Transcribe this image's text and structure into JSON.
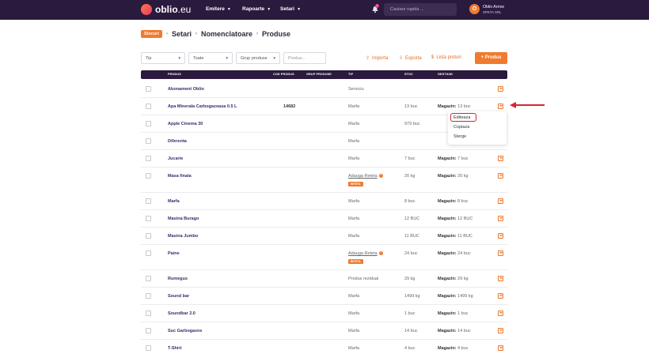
{
  "brand": {
    "name": "oblio",
    "tld": ".eu"
  },
  "nav": [
    {
      "label": "Emitere"
    },
    {
      "label": "Rapoarte"
    },
    {
      "label": "Setari"
    }
  ],
  "notifications": {
    "count": "1"
  },
  "search": {
    "placeholder": "Cautare rapida ..."
  },
  "user": {
    "initial": "O",
    "name": "Oblio Arrow",
    "company": "SPETA SRL"
  },
  "breadcrumb": {
    "badge": "Stocuri",
    "items": [
      "Setari",
      "Nomenclatoare",
      "Produse"
    ]
  },
  "filters": {
    "tip": "Tip",
    "toate": "Toate",
    "grup": "Grup produse",
    "produs_placeholder": "Produs..."
  },
  "actions": {
    "importa": "Importa",
    "exporta": "Exporta",
    "lista_preturi": "Lista preturi",
    "add_button": "+ Produs"
  },
  "columns": {
    "produs": "PRODUS",
    "cod": "COD PRODUS",
    "grup": "GRUP PRODUSE",
    "tip": "TIP",
    "stoc": "STOC",
    "gestiuni": "GESTIUNI"
  },
  "rows": [
    {
      "name": "Abonament Oblio",
      "code": "",
      "tip": "Serviciu",
      "stoc": "",
      "gest_label": "",
      "gest_value": ""
    },
    {
      "name": "Apa Minerala Carbogazoasa 0.5 L",
      "code": "14682",
      "tip": "Marfa",
      "stoc": "13 buc",
      "gest_label": "Magazin:",
      "gest_value": " 13 buc"
    },
    {
      "name": "Apple Cinema 30",
      "code": "",
      "tip": "Marfa",
      "stoc": "979 buc",
      "gest_label": "",
      "gest_value": ""
    },
    {
      "name": "Diferenta",
      "code": "",
      "tip": "Marfa",
      "stoc": "",
      "gest_label": "",
      "gest_value": ""
    },
    {
      "name": "Jucarie",
      "code": "",
      "tip": "Marfa",
      "stoc": "7 buc",
      "gest_label": "Magazin:",
      "gest_value": " 7 buc"
    },
    {
      "name": "Masa finala",
      "code": "",
      "tip": "Adauga Reteta",
      "tag": "RETETA",
      "stoc": "20 kg",
      "gest_label": "Magazin:",
      "gest_value": " 20 kg"
    },
    {
      "name": "Marfa",
      "code": "",
      "tip": "Marfa",
      "stoc": "8 buc",
      "gest_label": "Magazin:",
      "gest_value": " 8 buc"
    },
    {
      "name": "Masina Burago",
      "code": "",
      "tip": "Marfa",
      "stoc": "12 BUC",
      "gest_label": "Magazin:",
      "gest_value": " 12 BUC"
    },
    {
      "name": "Masina Jumbo",
      "code": "",
      "tip": "Marfa",
      "stoc": "11 BUC",
      "gest_label": "Magazin:",
      "gest_value": " 11 BUC"
    },
    {
      "name": "Paine",
      "code": "",
      "tip": "Adauga Reteta",
      "tag": "RETETA",
      "stoc": "24 buc",
      "gest_label": "Magazin:",
      "gest_value": " 24 buc"
    },
    {
      "name": "Rumegus",
      "code": "",
      "tip": "Produs rezidual",
      "stoc": "29 kg",
      "gest_label": "Magazin:",
      "gest_value": " 29 kg"
    },
    {
      "name": "Sound bar",
      "code": "",
      "tip": "Marfa",
      "stoc": "1499 kg",
      "gest_label": "Magazin:",
      "gest_value": " 1499 kg"
    },
    {
      "name": "Soundbar 2.0",
      "code": "",
      "tip": "Marfa",
      "stoc": "1 buc",
      "gest_label": "Magazin:",
      "gest_value": " 1 buc"
    },
    {
      "name": "Suc Garbogazos",
      "code": "",
      "tip": "Marfa",
      "stoc": "14 buc",
      "gest_label": "Magazin:",
      "gest_value": " 14 buc"
    },
    {
      "name": "T-Shirt",
      "code": "",
      "tip": "Marfa",
      "stoc": "4 buc",
      "gest_label": "Magazin:",
      "gest_value": " 4 buc"
    }
  ],
  "row_menu": {
    "edit": "Editeaza",
    "copy": "Copiaza",
    "delete": "Sterge"
  },
  "colors": {
    "accent": "#f07a2f",
    "nav_bg": "#2a1a3d",
    "annotation": "#d7242f"
  }
}
